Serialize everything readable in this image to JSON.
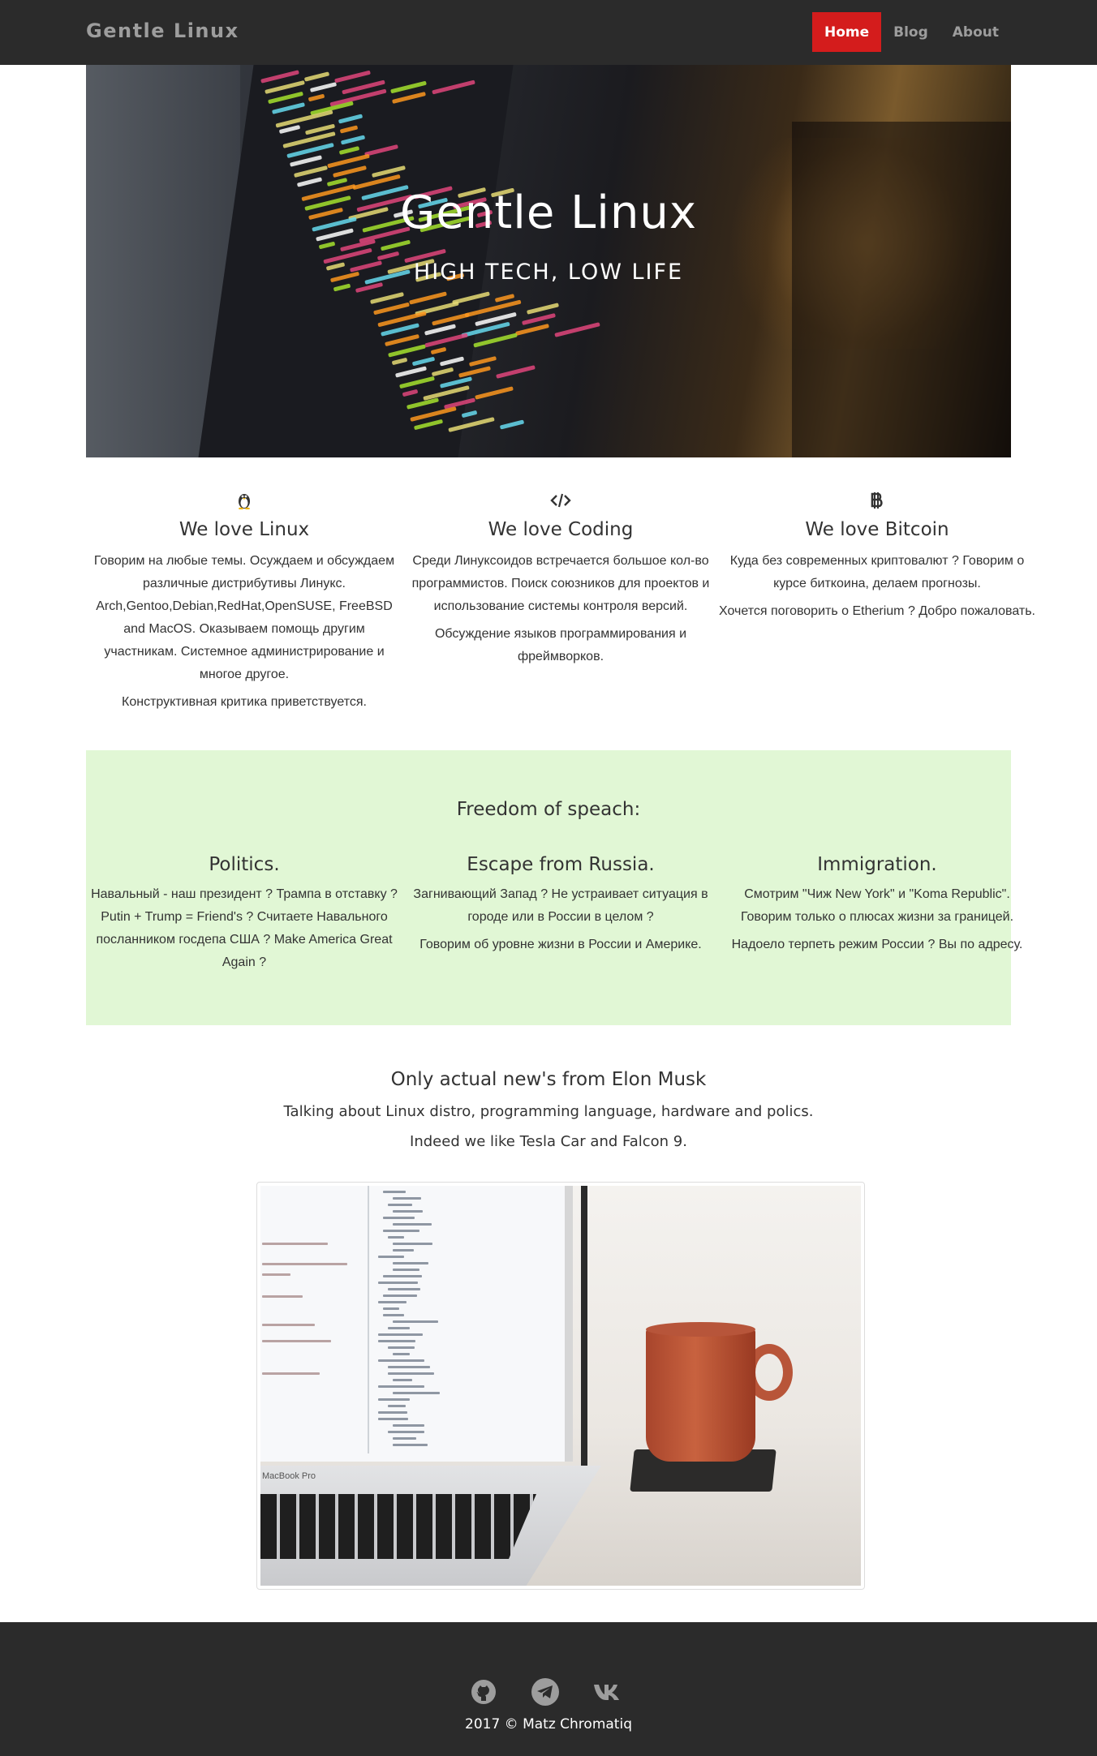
{
  "navbar": {
    "brand": "Gentle Linux",
    "links": [
      {
        "label": "Home",
        "active": true
      },
      {
        "label": "Blog",
        "active": false
      },
      {
        "label": "About",
        "active": false
      }
    ],
    "active_color": "#d41c1c"
  },
  "hero": {
    "title": "Gentle Linux",
    "subtitle": "HIGH TECH, LOW LIFE"
  },
  "features": [
    {
      "icon": "linux-penguin-icon",
      "title": "We love Linux",
      "paragraphs": [
        "Говорим на любые темы. Осуждаем и обсуждаем различные дистрибутивы Линукс. Arch,Gentoo,Debian,RedHat,OpenSUSE, FreeBSD and MacOS. Оказываем помощь другим участникам. Системное администрирование и многое другое.",
        "Конструктивная критика приветствуется."
      ]
    },
    {
      "icon": "code-icon",
      "title": "We love Coding",
      "paragraphs": [
        "Среди Линуксоидов встречается большое кол-во программистов. Поиск союзников для проектов и использование системы контроля версий.",
        "Обсуждение языков программирования и фреймворков."
      ]
    },
    {
      "icon": "bitcoin-icon",
      "title": "We love Bitcoin",
      "paragraphs": [
        "Куда без современных криптовалют ? Говорим о курсе биткоина, делаем прогнозы.",
        "Хочется поговорить о Etherium ? Добро пожаловать."
      ]
    }
  ],
  "freedom": {
    "heading": "Freedom of speach:",
    "background": "#e1f7d5",
    "columns": [
      {
        "title": "Politics.",
        "paragraphs": [
          "Навальный - наш президент ? Трампа в отставку ? Putin + Trump = Friend's ? Считаете Навального посланником госдепа США ? Make America Great Again ?"
        ]
      },
      {
        "title": "Escape from Russia.",
        "paragraphs": [
          "Загнивающий Запад ? Не устраивает ситуация в городе или в России в целом ?",
          "Говорим об уровне жизни в России и Америке."
        ]
      },
      {
        "title": "Immigration.",
        "paragraphs": [
          "Смотрим \"Чиж New York\" и \"Koma Republic\". Говорим только о плюсах жизни за границей.",
          "Надоело терпеть режим России ? Вы по адресу."
        ]
      }
    ]
  },
  "news": {
    "title": "Only actual new's from Elon Musk",
    "line1": "Talking about Linux distro, programming language, hardware and polics.",
    "line2": "Indeed we like Tesla Car and Falcon 9.",
    "photo_caption": "MacBook Pro"
  },
  "footer": {
    "social": [
      "github-icon",
      "telegram-icon",
      "vk-icon"
    ],
    "copyright": "2017 © Matz Chromatiq"
  }
}
